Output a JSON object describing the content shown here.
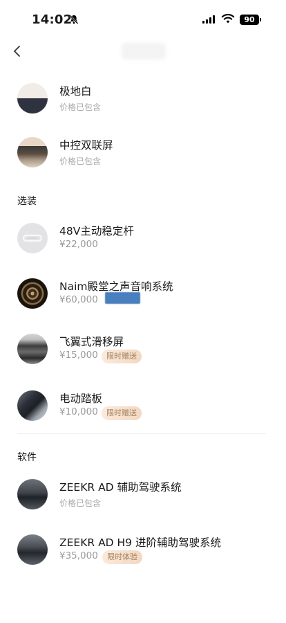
{
  "status": {
    "time": "14:02",
    "battery": "90"
  },
  "groups": [
    {
      "items": [
        {
          "name": "极地白",
          "sub": "价格已包含"
        },
        {
          "name": "中控双联屏",
          "sub": "价格已包含"
        }
      ]
    },
    {
      "title": "选装",
      "items": [
        {
          "name": "48V主动稳定杆",
          "price": "¥22,000"
        },
        {
          "name": "Naim殿堂之声音响系统",
          "price": "¥60,000"
        },
        {
          "name": "飞翼式滑移屏",
          "price": "¥15,000",
          "badge": "限时赠送"
        },
        {
          "name": "电动踏板",
          "price": "¥10,000",
          "badge": "限时赠送"
        }
      ]
    },
    {
      "title": "软件",
      "items": [
        {
          "name": "ZEEKR AD 辅助驾驶系统",
          "sub": "价格已包含"
        },
        {
          "name": "ZEEKR AD H9 进阶辅助驾驶系统",
          "price": "¥35,000",
          "badge": "限时体验"
        }
      ]
    }
  ]
}
